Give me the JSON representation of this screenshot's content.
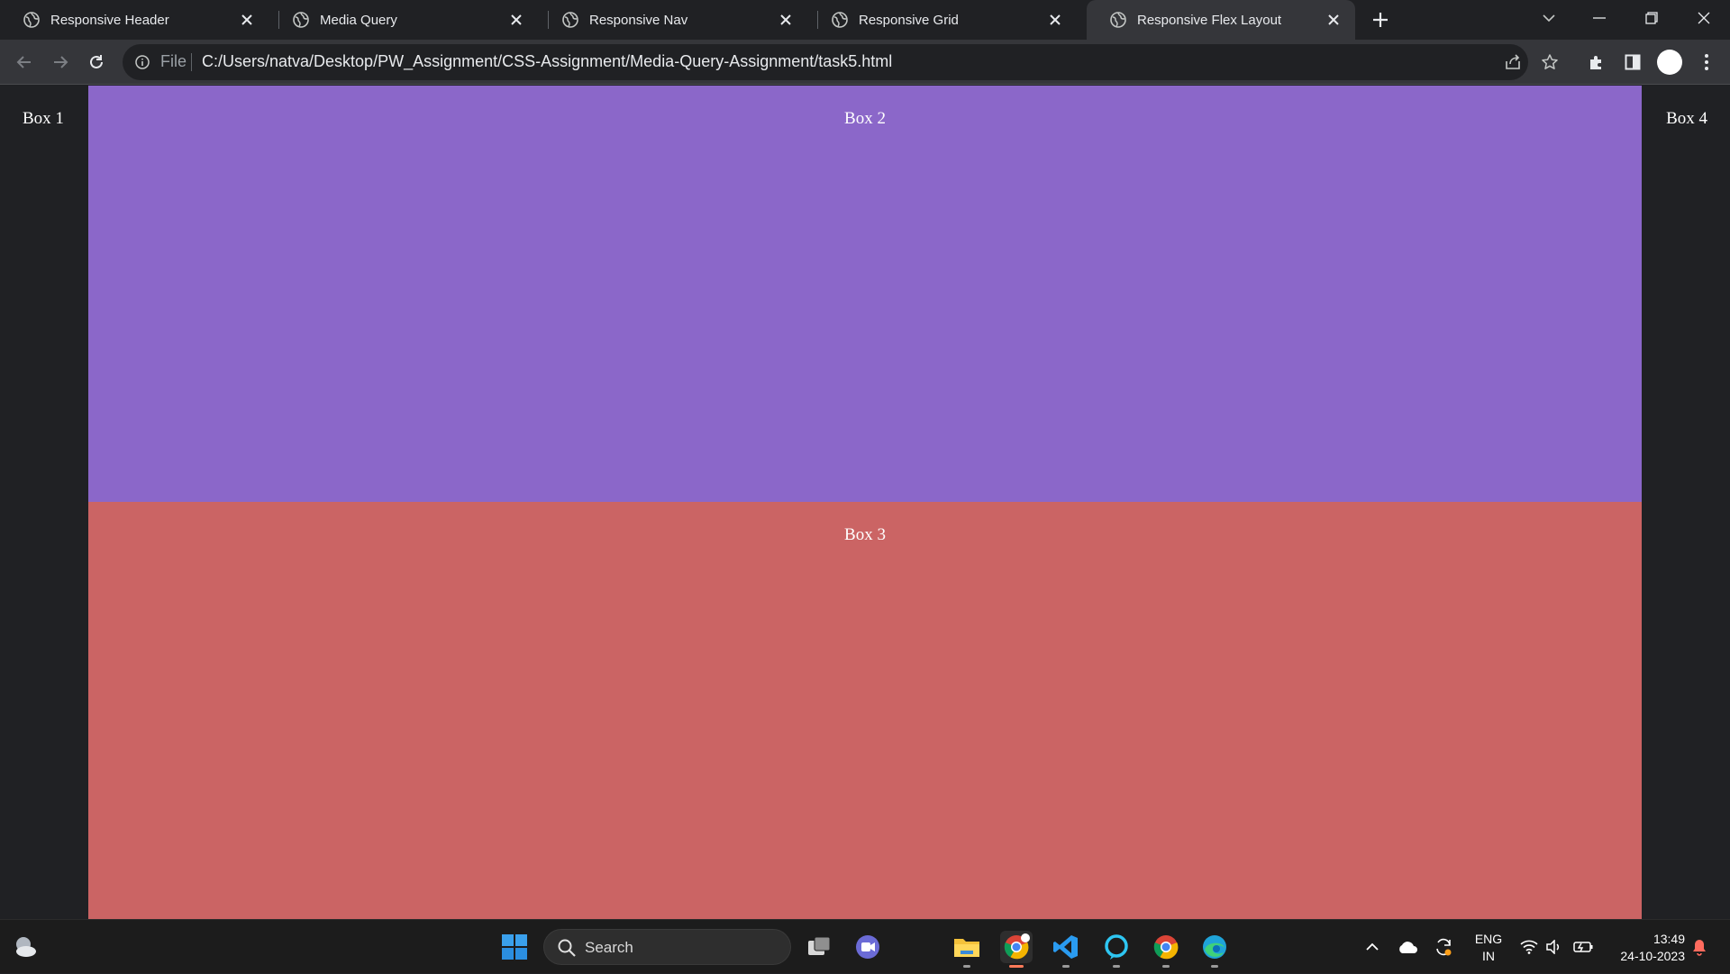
{
  "browser": {
    "tabs": [
      {
        "title": "Responsive Header",
        "active": false
      },
      {
        "title": "Media Query",
        "active": false
      },
      {
        "title": "Responsive Nav",
        "active": false
      },
      {
        "title": "Responsive Grid",
        "active": false
      },
      {
        "title": "Responsive Flex Layout",
        "active": true
      }
    ],
    "omnibox": {
      "scheme_label": "File",
      "url": "C:/Users/natva/Desktop/PW_Assignment/CSS-Assignment/Media-Query-Assignment/task5.html"
    }
  },
  "page": {
    "box1": "Box 1",
    "box2": "Box 2",
    "box3": "Box 3",
    "box4": "Box 4",
    "colors": {
      "background": "#202124",
      "box2": "#8b67c9",
      "box3": "#cb6464",
      "text": "#ffffff"
    }
  },
  "taskbar": {
    "search_label": "Search",
    "language": {
      "line1": "ENG",
      "line2": "IN"
    },
    "clock": {
      "time": "13:49",
      "date": "24-10-2023"
    }
  }
}
